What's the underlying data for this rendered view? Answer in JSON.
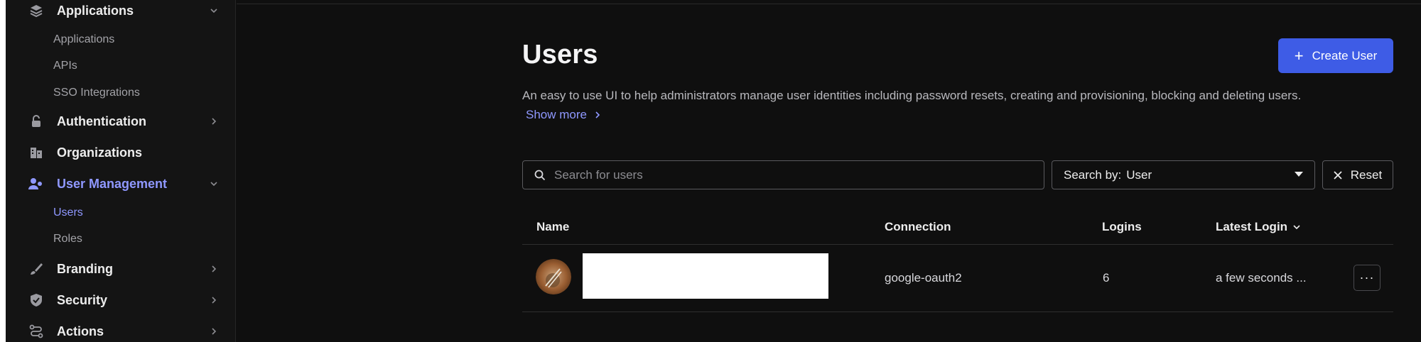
{
  "sidebar": {
    "applications": {
      "label": "Applications",
      "icon": "layers-icon"
    },
    "applications_sub": [
      "Applications",
      "APIs",
      "SSO Integrations"
    ],
    "authentication": {
      "label": "Authentication",
      "icon": "lock-icon"
    },
    "organizations": {
      "label": "Organizations",
      "icon": "building-icon"
    },
    "user_management": {
      "label": "User Management",
      "icon": "users-icon"
    },
    "user_management_sub": [
      "Users",
      "Roles"
    ],
    "branding": {
      "label": "Branding",
      "icon": "brush-icon"
    },
    "security": {
      "label": "Security",
      "icon": "shield-check-icon"
    },
    "actions": {
      "label": "Actions",
      "icon": "flow-icon"
    }
  },
  "page": {
    "title": "Users",
    "create_button": "Create User",
    "description": "An easy to use UI to help administrators manage user identities including password resets, creating and provisioning, blocking and deleting users.",
    "show_more": "Show more"
  },
  "search": {
    "placeholder": "Search for users",
    "search_by_label": "Search by:",
    "search_by_value": "User",
    "reset": "Reset"
  },
  "table": {
    "columns": {
      "name": "Name",
      "connection": "Connection",
      "logins": "Logins",
      "latest_login": "Latest Login"
    },
    "rows": [
      {
        "connection": "google-oauth2",
        "logins": "6",
        "latest_login": "a few seconds ...",
        "actions": "···"
      }
    ]
  },
  "colors": {
    "accent": "#3e5ce6",
    "active_nav": "#8f98ff",
    "background": "#0f0f0f",
    "sidebar": "#141414"
  }
}
